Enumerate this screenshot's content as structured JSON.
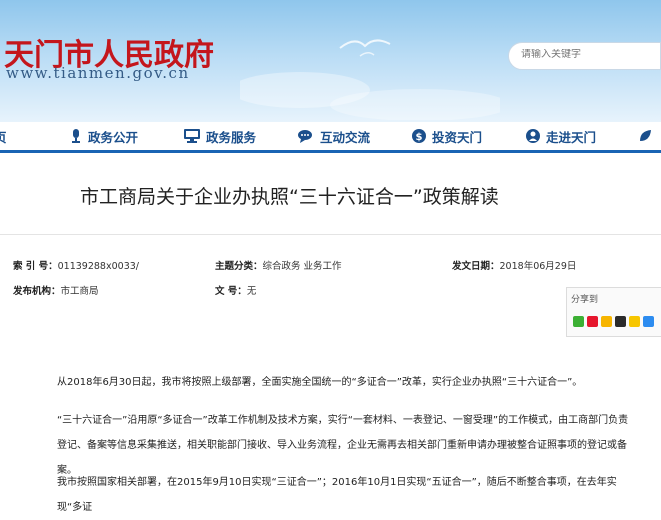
{
  "header": {
    "site_name": "天门市人民政府",
    "site_url": "www.tianmen.gov.cn",
    "search_placeholder": "请输入关键字"
  },
  "nav": {
    "items": [
      {
        "label": "页",
        "icon": "home-icon"
      },
      {
        "label": "政务公开",
        "icon": "microphone-icon"
      },
      {
        "label": "政务服务",
        "icon": "monitor-icon"
      },
      {
        "label": "互动交流",
        "icon": "chat-icon"
      },
      {
        "label": "投资天门",
        "icon": "money-icon"
      },
      {
        "label": "走进天门",
        "icon": "person-icon"
      },
      {
        "label": "",
        "icon": "leaf-icon"
      }
    ]
  },
  "article": {
    "title": "市工商局关于企业办执照“三十六证合一”政策解读",
    "meta": {
      "index_label": "索 引 号：",
      "index_value": "01139288x0033/",
      "topic_label": "主题分类：",
      "topic_value": "综合政务    业务工作",
      "date_label": "发文日期：",
      "date_value": "2018年06月29日",
      "org_label": "发布机构：",
      "org_value": "市工商局",
      "docno_label": "文    号：",
      "docno_value": "无"
    },
    "share_label": "分享到",
    "paragraphs": [
      "从2018年6月30日起，我市将按照上级部署，全面实施全国统一的“多证合一”改革，实行企业办执照“三十六证合一”。",
      "“三十六证合一”沿用原“多证合一”改革工作机制及技术方案，实行“一套材料、一表登记、一窗受理”的工作模式，由工商部门负责登记、备案等信息采集推送，相关职能部门接收、导入业务流程，企业无需再去相关部门重新申请办理被整合证照事项的登记或备案。",
      "我市按照国家相关部署，在2015年9月10日实现“三证合一”；2016年10月1日实现“五证合一”，随后不断整合事项，在去年实现“多证"
    ]
  },
  "colors": {
    "brand_red": "#c4161c",
    "nav_blue": "#1964b4",
    "nav_text": "#1b4f8c"
  }
}
